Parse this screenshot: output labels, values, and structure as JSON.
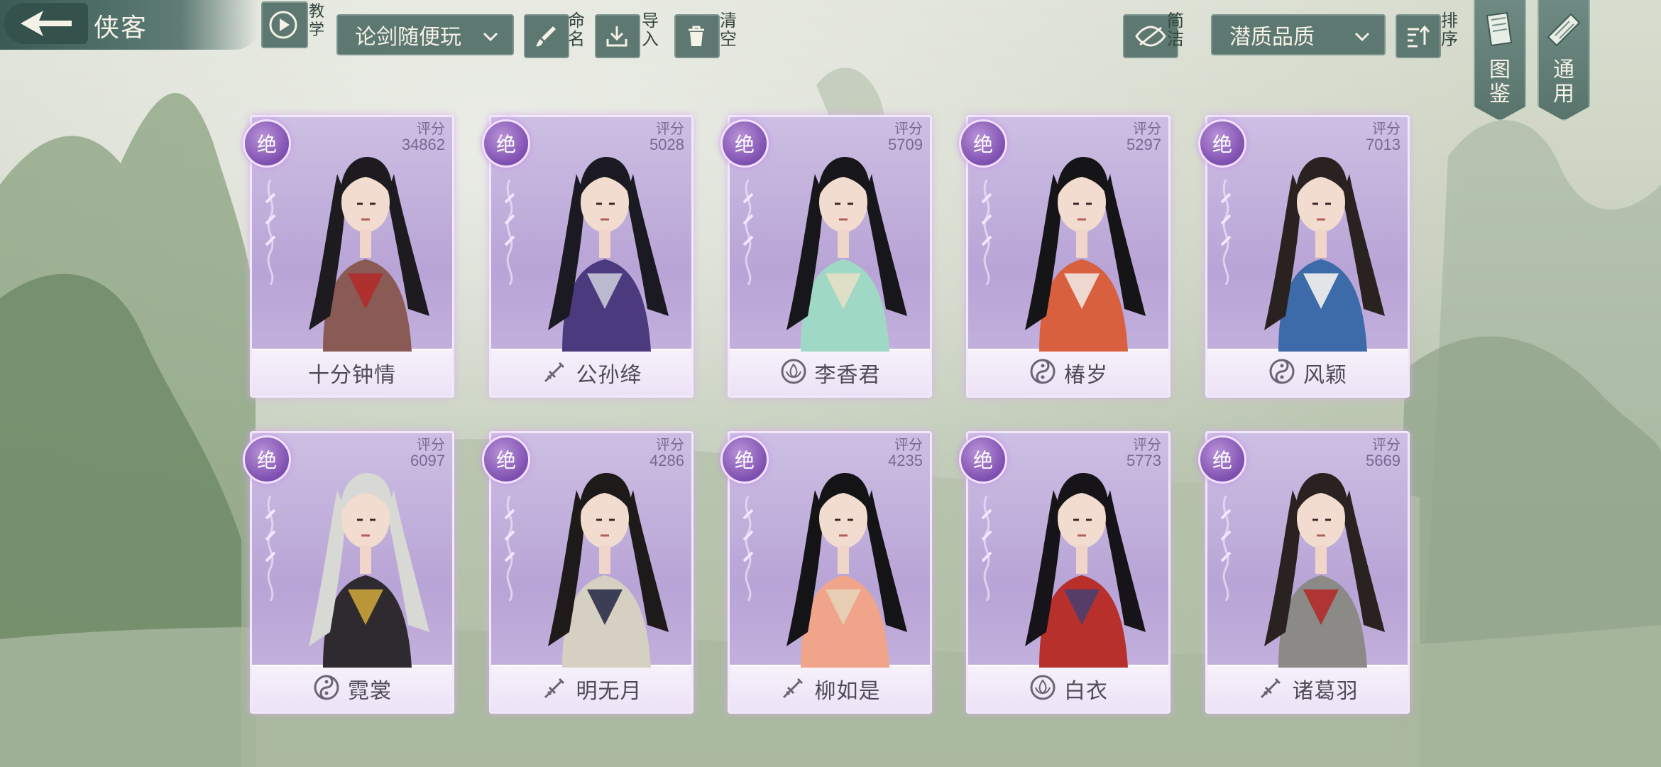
{
  "header": {
    "title": "侠客",
    "tutorial_label": "教学",
    "mode_select": "论剑随便玩",
    "rename_label": "命名",
    "import_label": "导入",
    "clear_label": "清空",
    "simple_label": "简洁",
    "sort_select": "潜质品质",
    "sort_label": "排序"
  },
  "side_tabs": {
    "atlas": "图鉴",
    "general": "通用"
  },
  "cards": [
    {
      "rarity": "绝",
      "score_label": "评分",
      "score": "34862",
      "name": "十分钟情",
      "sect_icon": "",
      "hair": "#1d1b1f",
      "robe": "#8a5a55",
      "accent": "#b12b2b"
    },
    {
      "rarity": "绝",
      "score_label": "评分",
      "score": "5028",
      "name": "公孙绛",
      "sect_icon": "sword-sect-icon",
      "hair": "#1b1a22",
      "robe": "#4b3a7e",
      "accent": "#c8c8d8"
    },
    {
      "rarity": "绝",
      "score_label": "评分",
      "score": "5709",
      "name": "李香君",
      "sect_icon": "lotus-sect-icon",
      "hair": "#17161a",
      "robe": "#9fd8c4",
      "accent": "#e6e0c8"
    },
    {
      "rarity": "绝",
      "score_label": "评分",
      "score": "5297",
      "name": "椿岁",
      "sect_icon": "taiji-sect-icon",
      "hair": "#151417",
      "robe": "#d8603e",
      "accent": "#f2e6df"
    },
    {
      "rarity": "绝",
      "score_label": "评分",
      "score": "7013",
      "name": "风颖",
      "sect_icon": "taiji-sect-icon",
      "hair": "#2a2220",
      "robe": "#3d6aa8",
      "accent": "#f5f2ee"
    },
    {
      "rarity": "绝",
      "score_label": "评分",
      "score": "6097",
      "name": "霓裳",
      "sect_icon": "taiji-sect-icon",
      "hair": "#d8d8d4",
      "robe": "#2e2a30",
      "accent": "#c9a23a"
    },
    {
      "rarity": "绝",
      "score_label": "评分",
      "score": "4286",
      "name": "明无月",
      "sect_icon": "sword-sect-icon",
      "hair": "#1e1a1a",
      "robe": "#d6d0c2",
      "accent": "#2b2d4a"
    },
    {
      "rarity": "绝",
      "score_label": "评分",
      "score": "4235",
      "name": "柳如是",
      "sect_icon": "sword-sect-icon",
      "hair": "#141316",
      "robe": "#f0a48a",
      "accent": "#e6d2b8"
    },
    {
      "rarity": "绝",
      "score_label": "评分",
      "score": "5773",
      "name": "白衣",
      "sect_icon": "lotus-sect-icon",
      "hair": "#161418",
      "robe": "#b7302c",
      "accent": "#4a3f6e"
    },
    {
      "rarity": "绝",
      "score_label": "评分",
      "score": "5669",
      "name": "诸葛羽",
      "sect_icon": "sword-sect-icon",
      "hair": "#2a2220",
      "robe": "#8c8a86",
      "accent": "#b12b2b"
    }
  ],
  "colors": {
    "toolbar_bg": "#5d7771",
    "card_bg": "#b8a4d6",
    "rarity_badge": "#7e4fb0"
  }
}
